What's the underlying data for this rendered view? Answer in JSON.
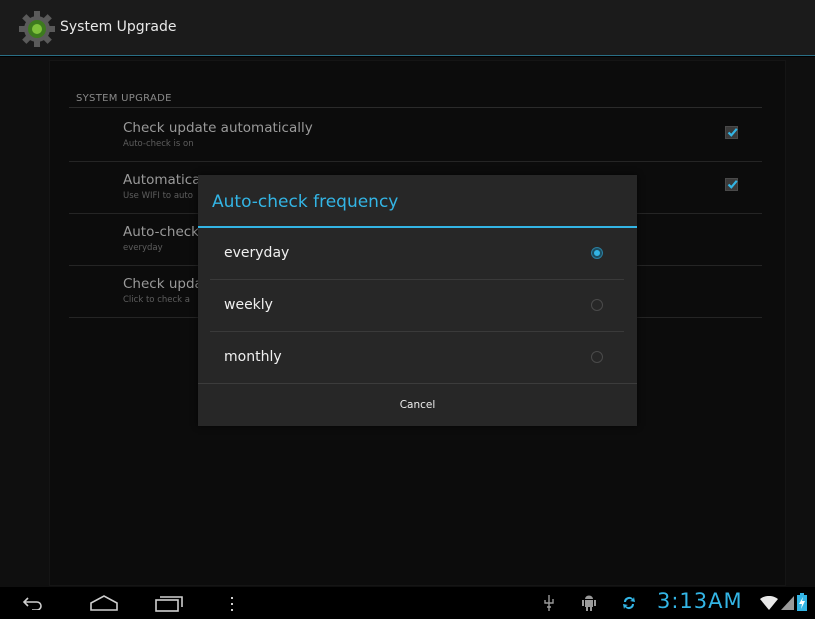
{
  "actionbar": {
    "title": "System Upgrade",
    "app_icon": "gear-icon"
  },
  "settings": {
    "section_header": "SYSTEM UPGRADE",
    "items": [
      {
        "title": "Check update automatically",
        "summary": "Auto-check is on",
        "checked": true
      },
      {
        "title": "Automatica",
        "summary": "Use WIFI to auto",
        "checked": true
      },
      {
        "title": "Auto-check",
        "summary": "everyday",
        "checked": null
      },
      {
        "title": "Check upda",
        "summary": "Click to check a",
        "checked": null
      }
    ]
  },
  "dialog": {
    "title": "Auto-check frequency",
    "options": [
      {
        "label": "everyday",
        "selected": true
      },
      {
        "label": "weekly",
        "selected": false
      },
      {
        "label": "monthly",
        "selected": false
      }
    ],
    "cancel_label": "Cancel"
  },
  "navbar": {
    "back": "back-icon",
    "home": "home-icon",
    "recents": "recent-apps-icon",
    "menu": "overflow-menu-icon",
    "status_icons": [
      "usb-icon",
      "android-debug-icon",
      "sync-icon"
    ],
    "time": "3:13AM",
    "wifi": "wifi-icon",
    "signal": "signal-icon",
    "battery": "battery-charging-icon"
  },
  "colors": {
    "accent": "#33b5e5",
    "dialog_bg": "#272727",
    "actionbar_bg": "#1b1b1b"
  }
}
